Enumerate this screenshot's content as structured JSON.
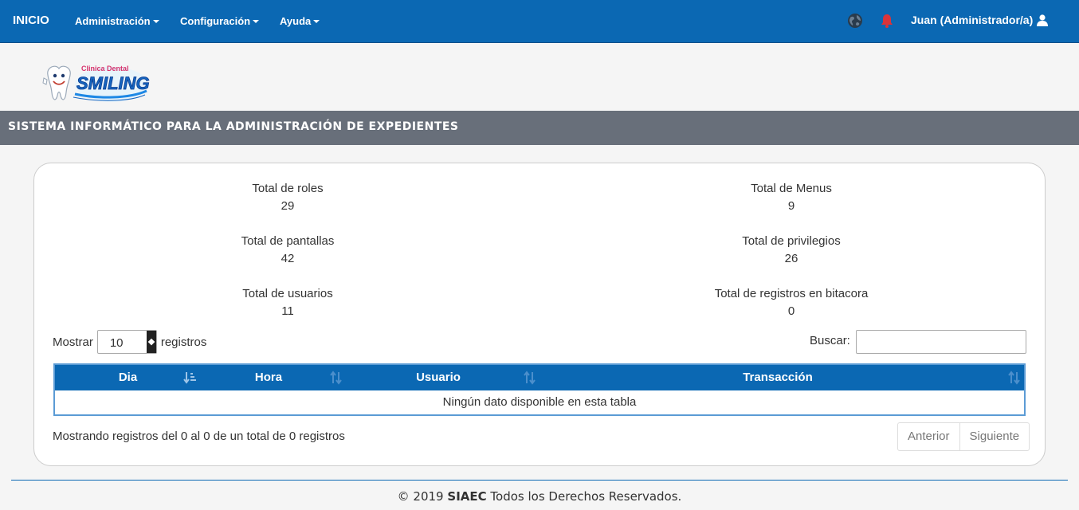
{
  "navbar": {
    "brand": "INICIO",
    "menus": [
      {
        "label": "Administración"
      },
      {
        "label": "Configuración"
      },
      {
        "label": "Ayuda"
      }
    ],
    "user": "Juan (Administrador/a)",
    "icons": {
      "globe": "globe-icon",
      "bell": "bell-icon",
      "user": "user-icon"
    },
    "colors": {
      "primary": "#0b68b3",
      "bell": "#d9343a"
    }
  },
  "logo": {
    "brand_top": "Clinica Dental",
    "brand_name": "SMILING"
  },
  "header": {
    "title": "SISTEMA INFORMÁTICO PARA LA ADMINISTRACIÓN DE EXPEDIENTES"
  },
  "stats": [
    {
      "label": "Total de roles",
      "value": "29"
    },
    {
      "label": "Total de Menus",
      "value": "9"
    },
    {
      "label": "Total de pantallas",
      "value": "42"
    },
    {
      "label": "Total de privilegios",
      "value": "26"
    },
    {
      "label": "Total de usuarios",
      "value": "11"
    },
    {
      "label": "Total de registros en bitacora",
      "value": "0"
    }
  ],
  "table_controls": {
    "show_label": "Mostrar",
    "page_size": "10",
    "records_label": "registros",
    "search_label": "Buscar:",
    "search_value": ""
  },
  "table": {
    "columns": [
      "Dia",
      "Hora",
      "Usuario",
      "Transacción"
    ],
    "empty_message": "Ningún dato disponible en esta tabla"
  },
  "pagination": {
    "info": "Mostrando registros del 0 al 0 de un total de 0 registros",
    "prev": "Anterior",
    "next": "Siguiente"
  },
  "footer": {
    "prefix": "© 2019",
    "brand": "SIAEC",
    "suffix": "Todos los Derechos Reservados."
  }
}
